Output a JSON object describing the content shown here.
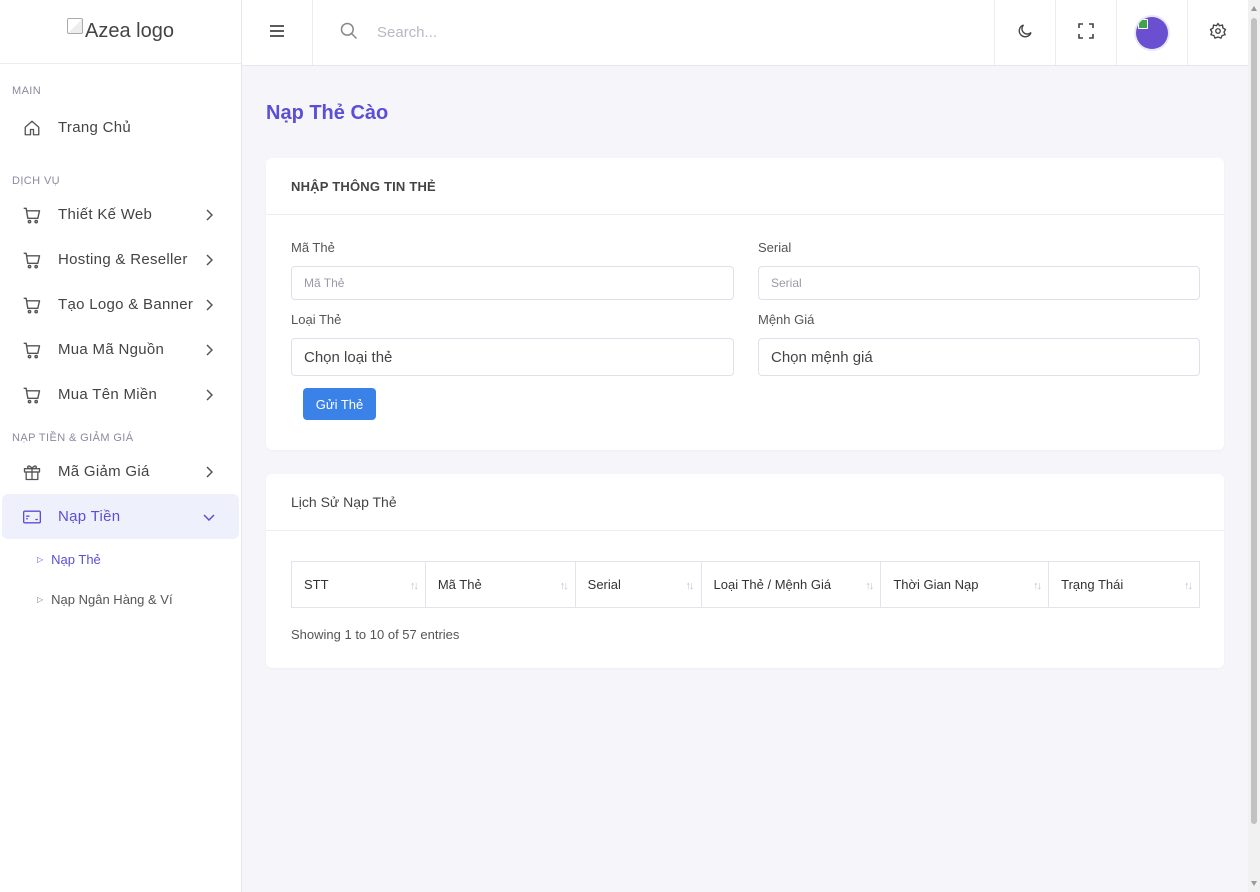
{
  "sidebar": {
    "logo_alt": "Azea logo",
    "sections": [
      {
        "title": "MAIN"
      },
      {
        "title": "DỊCH VỤ"
      },
      {
        "title": "NẠP TIỀN & GIẢM GIÁ"
      }
    ],
    "items": [
      {
        "label": "Trang Chủ",
        "icon": "home-icon"
      },
      {
        "label": "Thiết Kế Web",
        "icon": "cart-icon"
      },
      {
        "label": "Hosting & Reseller",
        "icon": "cart-icon"
      },
      {
        "label": "Tạo Logo & Banner",
        "icon": "cart-icon"
      },
      {
        "label": "Mua Mã Nguồn",
        "icon": "cart-icon"
      },
      {
        "label": "Mua Tên Miền",
        "icon": "cart-icon"
      },
      {
        "label": "Mã Giảm Giá",
        "icon": "gift-icon"
      },
      {
        "label": "Nạp Tiền",
        "icon": "card-icon"
      }
    ],
    "submenu": [
      {
        "label": "Nạp Thẻ"
      },
      {
        "label": "Nạp Ngân Hàng & Ví"
      }
    ]
  },
  "header": {
    "search_placeholder": "Search..."
  },
  "page": {
    "title": "Nạp Thẻ Cào"
  },
  "form": {
    "heading": "NHẬP THÔNG TIN THẺ",
    "ma_the_label": "Mã Thẻ",
    "ma_the_placeholder": "Mã Thẻ",
    "serial_label": "Serial",
    "serial_placeholder": "Serial",
    "loai_the_label": "Loại Thẻ",
    "loai_the_value": "Chọn loại thẻ",
    "menh_gia_label": "Mệnh Giá",
    "menh_gia_value": "Chọn mệnh giá",
    "submit_label": "Gửi Thẻ"
  },
  "history": {
    "heading": "Lịch Sử Nạp Thẻ",
    "columns": [
      "STT",
      "Mã Thẻ",
      "Serial",
      "Loại Thẻ / Mệnh Giá",
      "Thời Gian Nạp",
      "Trạng Thái"
    ],
    "sort_glyph": "↑↓",
    "info": "Showing 1 to 10 of 57 entries"
  },
  "colors": {
    "accent": "#5b4fd6",
    "button": "#3b82e8",
    "background": "#f5f5fa"
  }
}
